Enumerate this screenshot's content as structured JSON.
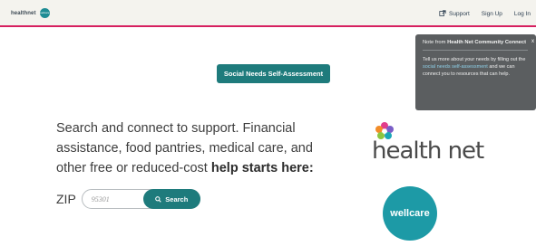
{
  "brand": {
    "logo_text": "healthnet",
    "badge_text": "wellcare"
  },
  "nav": {
    "support_label": "Support",
    "signup_label": "Sign Up",
    "login_label": "Log In"
  },
  "cta": {
    "label": "Social Needs Self-Assessment"
  },
  "hero": {
    "text_line": "Search and connect to support. Financial assistance, food pantries, medical care, and other free or reduced-cost",
    "highlight": "help starts here:"
  },
  "zip": {
    "label": "ZIP",
    "placeholder": "95301",
    "search_label": "Search"
  },
  "logos": {
    "healthnet": "health net",
    "wellcare": "wellcare"
  },
  "notice": {
    "title_prefix": "Note from",
    "title_bold": "Health Net Community Connect",
    "body_before": "Tell us more about your needs by filling out the",
    "link_text": "social needs self-assessment",
    "body_after": "and we can connect you to resources that can help.",
    "close": "x"
  },
  "colors": {
    "accent": "#1e7b7c",
    "nav_border": "#d6205f",
    "notice_bg": "#5b5e60",
    "wellcare": "#1d9aa6"
  }
}
